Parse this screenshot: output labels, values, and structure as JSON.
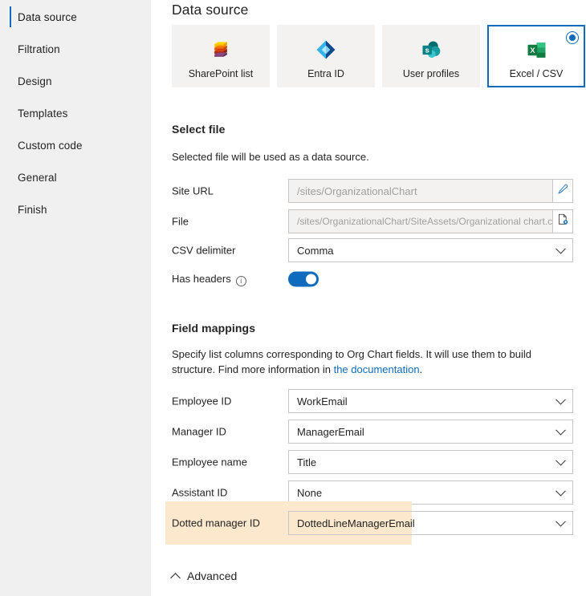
{
  "sidebar": {
    "items": [
      {
        "label": "Data source",
        "active": true
      },
      {
        "label": "Filtration",
        "active": false
      },
      {
        "label": "Design",
        "active": false
      },
      {
        "label": "Templates",
        "active": false
      },
      {
        "label": "Custom code",
        "active": false
      },
      {
        "label": "General",
        "active": false
      },
      {
        "label": "Finish",
        "active": false
      }
    ]
  },
  "main": {
    "title": "Data source",
    "cards": [
      {
        "label": "SharePoint list",
        "icon": "sharepoint-list-icon",
        "selected": false
      },
      {
        "label": "Entra ID",
        "icon": "entra-id-icon",
        "selected": false
      },
      {
        "label": "User profiles",
        "icon": "user-profiles-icon",
        "selected": false
      },
      {
        "label": "Excel / CSV",
        "icon": "excel-csv-icon",
        "selected": true
      }
    ],
    "select_file": {
      "heading": "Select file",
      "description": "Selected file will be used as a data source.",
      "site_url": {
        "label": "Site URL",
        "value": "/sites/OrganizationalChart",
        "action_icon": "pencil-icon"
      },
      "file": {
        "label": "File",
        "value": "/sites/OrganizationalChart/SiteAssets/Organizational chart.csv",
        "action_icon": "file-icon"
      },
      "csv_delimiter": {
        "label": "CSV delimiter",
        "value": "Comma"
      },
      "has_headers": {
        "label": "Has headers",
        "info_icon": "info-icon",
        "enabled": true
      }
    },
    "field_mappings": {
      "heading": "Field mappings",
      "description_before_link": "Specify list columns corresponding to Org Chart fields. It will use them to build structure. Find more information in ",
      "link_text": "the documentation",
      "description_after_link": ".",
      "rows": [
        {
          "label": "Employee ID",
          "value": "WorkEmail",
          "highlighted": false
        },
        {
          "label": "Manager ID",
          "value": "ManagerEmail",
          "highlighted": false
        },
        {
          "label": "Employee name",
          "value": "Title",
          "highlighted": false
        },
        {
          "label": "Assistant ID",
          "value": "None",
          "highlighted": false
        },
        {
          "label": "Dotted manager ID",
          "value": "DottedLineManagerEmail",
          "highlighted": true
        }
      ]
    },
    "advanced": {
      "label": "Advanced",
      "expanded": true,
      "caret_icon": "chevron-up-icon"
    }
  },
  "colors": {
    "accent": "#0f6cbd",
    "highlight": "#fce8cc",
    "sidebar_bg": "#f0f0f0",
    "card_bg": "#f3f2f1"
  }
}
